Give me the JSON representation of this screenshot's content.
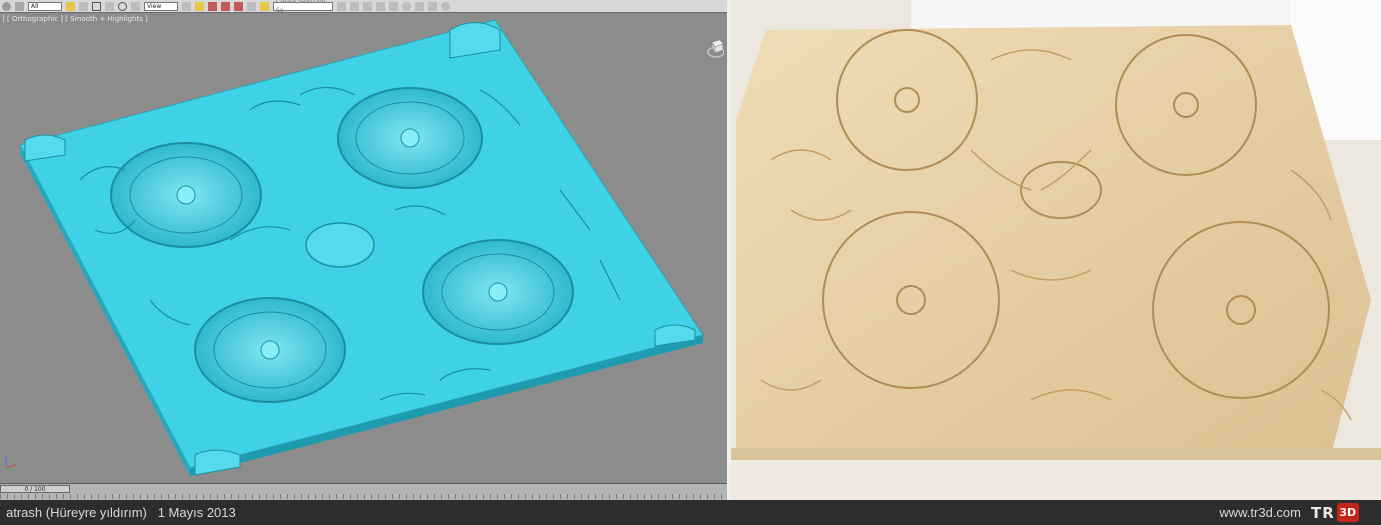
{
  "viewport": {
    "label": "] [ Orthographic ] [ Smooth + Highlights ]",
    "toolbar": {
      "filter_value": "All",
      "view_value": "View",
      "selection_set_placeholder": "Create Selection Se"
    },
    "time_slider_label": "0 / 100",
    "model_color": "#3fd1e6",
    "background_color": "#8c8c8c"
  },
  "photo": {
    "wood_color": "#e9d3aa"
  },
  "footer": {
    "caption": "atrash (Hüreyre yıldırım)   1 Mayıs 2013",
    "site": "www.tr3d.com",
    "logo_letters": "TR",
    "logo_badge": "3D"
  }
}
